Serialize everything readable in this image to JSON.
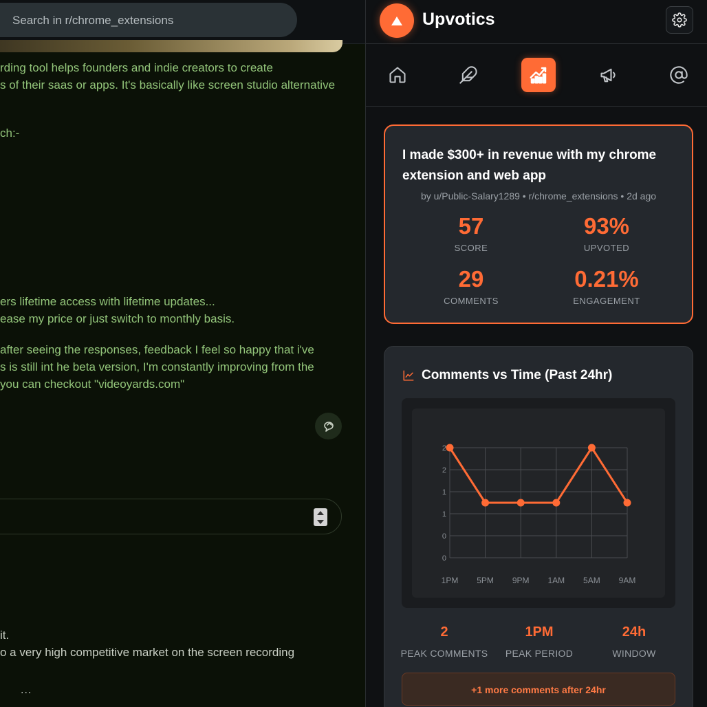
{
  "reddit": {
    "search_placeholder": "Search in r/chrome_extensions",
    "post_lines": [
      "rding tool helps founders and indie creators to create",
      "s of their saas or apps. It's basically like screen studio alternative",
      "ch:-",
      "ers lifetime access with lifetime updates...",
      "ease my price or just switch to monthly basis.",
      " after seeing the responses, feedback I feel so happy that i've",
      "s is still int he beta version, I'm constantly improving from the",
      "you can checkout \"videoyards.com\""
    ],
    "comment_lines": [
      "it.",
      "o a very high competitive market on the screen recording"
    ],
    "more_dots": "..."
  },
  "panel": {
    "app_title": "Upvotics",
    "nav": [
      {
        "name": "home-icon"
      },
      {
        "name": "feather-icon"
      },
      {
        "name": "analytics-icon",
        "active": true
      },
      {
        "name": "megaphone-icon"
      },
      {
        "name": "at-mention-icon"
      }
    ],
    "accent_color": "#ff6b35",
    "post": {
      "title": "I made $300+ in revenue with my chrome extension and web app",
      "meta": "by u/Public-Salary1289 • r/chrome_extensions • 2d ago",
      "stats": [
        {
          "value": "57",
          "label": "SCORE"
        },
        {
          "value": "93%",
          "label": "UPVOTED"
        },
        {
          "value": "29",
          "label": "COMMENTS"
        },
        {
          "value": "0.21%",
          "label": "ENGAGEMENT"
        }
      ]
    },
    "chart_title": "Comments vs Time (Past 24hr)",
    "peaks": [
      {
        "value": "2",
        "label": "PEAK COMMENTS"
      },
      {
        "value": "1PM",
        "label": "PEAK PERIOD"
      },
      {
        "value": "24h",
        "label": "WINDOW"
      }
    ],
    "more_button": "+1 more comments after 24hr"
  },
  "chart_data": {
    "type": "line",
    "title": "Comments vs Time (Past 24hr)",
    "categories": [
      "1PM",
      "5PM",
      "9PM",
      "1AM",
      "5AM",
      "9AM"
    ],
    "values": [
      2,
      1,
      1,
      1,
      2,
      1
    ],
    "y_tick_labels": [
      "0",
      "0",
      "1",
      "1",
      "2",
      "2"
    ],
    "ylim": [
      0,
      2
    ],
    "grid": true,
    "color": "#ff6b35"
  }
}
